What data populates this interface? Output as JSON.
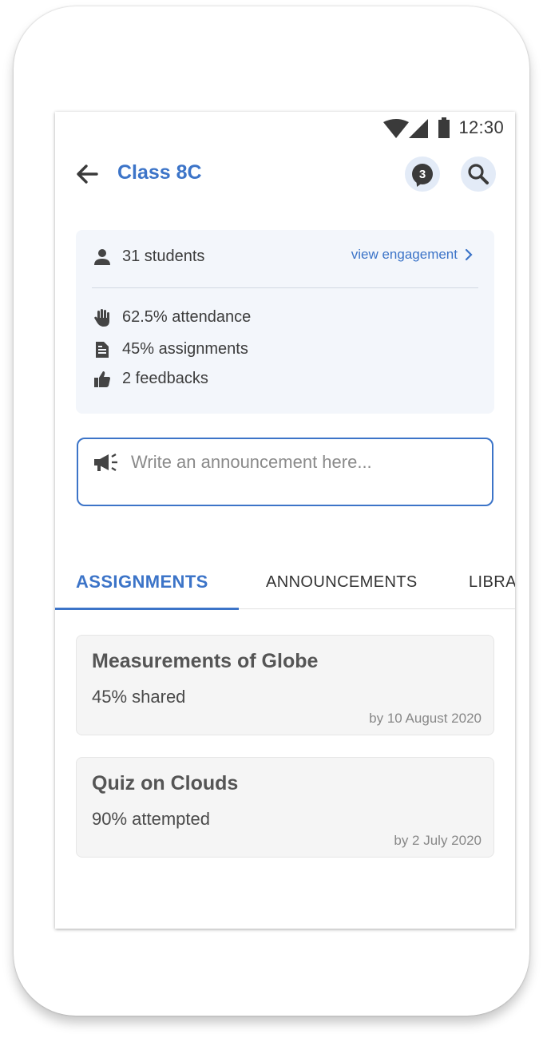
{
  "status_bar": {
    "time": "12:30",
    "icons": [
      "wifi-icon",
      "signal-icon",
      "battery-icon"
    ]
  },
  "header": {
    "title": "Class 8C",
    "notification_count": "3",
    "back_icon": "arrow-left-icon",
    "search_icon": "search-icon"
  },
  "summary": {
    "students": "31 students",
    "view_engagement": "view engagement",
    "attendance": "62.5% attendance",
    "assignments": "45% assignments",
    "feedbacks": "2 feedbacks"
  },
  "announcement": {
    "placeholder": "Write an announcement here..."
  },
  "tabs": [
    {
      "label": "ASSIGNMENTS",
      "active": true
    },
    {
      "label": "ANNOUNCEMENTS",
      "active": false
    },
    {
      "label": "LIBRA",
      "active": false
    }
  ],
  "assignments": [
    {
      "title": "Measurements of Globe",
      "stat": "45% shared",
      "due": "by 10 August 2020"
    },
    {
      "title": "Quiz on Clouds",
      "stat": "90% attempted",
      "due": "by 2 July 2020"
    }
  ],
  "colors": {
    "accent": "#3c74c8",
    "card_bg": "#f3f6fb",
    "icon_bg": "#e3ebf7"
  }
}
